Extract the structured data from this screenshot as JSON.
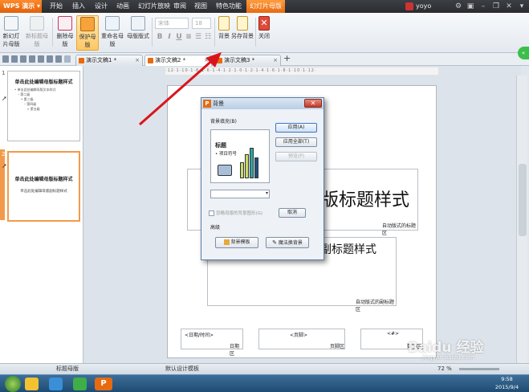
{
  "app": {
    "name": "WPS 演示"
  },
  "menu": {
    "items": [
      "开始",
      "插入",
      "设计",
      "动画",
      "幻灯片放映",
      "审阅",
      "视图",
      "特色功能",
      "幻灯片母版"
    ],
    "user": "yoyo"
  },
  "ribbon": {
    "buttons": {
      "new_slide_master": "新幻灯片母版",
      "new_title_master": "新标题母版",
      "delete_master": "删除母版",
      "protect_master": "保护母版",
      "rename_master": "重命名母版",
      "master_layout": "母版版式",
      "background": "背景",
      "save_background": "另存背景",
      "close": "关闭"
    },
    "font_name": "宋体",
    "font_size": "18"
  },
  "tabs": [
    "演示文稿1 *",
    "演示文稿2 *",
    "演示文稿3 *"
  ],
  "thumbnails": [
    {
      "num": "1",
      "title": "单击此处编辑母版标题样式",
      "bullets": [
        "• 单击此处编辑母版文本样式",
        "– 第二级",
        "• 第三级",
        "– 第四级",
        "» 第五级"
      ]
    },
    {
      "num": "2",
      "title": "单击此处编辑母版标题样式",
      "subtitle": "单击此处编辑母版副标题样式"
    }
  ],
  "slide": {
    "title_text": "版标题样式",
    "title_area_label": "自动版式的标题区",
    "subtitle_text": "副标题样式",
    "subtitle_area_label": "自动版式的副标题区",
    "date_placeholder": "<日期/时间>",
    "date_label": "日期区",
    "footer_placeholder": "<页脚>",
    "footer_label": "页脚区",
    "number_placeholder": "<#>",
    "number_label": "数字区"
  },
  "ruler_text": "·12·1·10·1·8·1·6·1·4·1·2·1·0·1·2·1·4·1·6·1·8·1·10·1·12·",
  "dialog": {
    "title": "背景",
    "close": "✕",
    "fill_group": "背景填充(B)",
    "preview_title": "标题",
    "preview_bullet": "• 项目符号",
    "apply": "应用(A)",
    "apply_all": "应用全部(T)",
    "preview_btn": "预览(P)",
    "omit_graphics": "忽略母版的背景图形(G)",
    "cancel": "取消",
    "advanced": "高级",
    "bg_template": "背景模板",
    "magic_bg": "魔法换背景"
  },
  "statusbar": {
    "left": "标题母版",
    "mid": "默认设计模板",
    "zoom": "72 %"
  },
  "clock": {
    "time": "9:58",
    "date": "2015/9/4"
  },
  "watermark": {
    "text": "Baidu 经验",
    "url": "jingyan.baidu.com"
  },
  "colors": {
    "accent": "#e86a10",
    "arrow": "#d9151b",
    "bar1": "#c9d96a",
    "bar2": "#2aa8a0",
    "bar3": "#1f4f86"
  }
}
